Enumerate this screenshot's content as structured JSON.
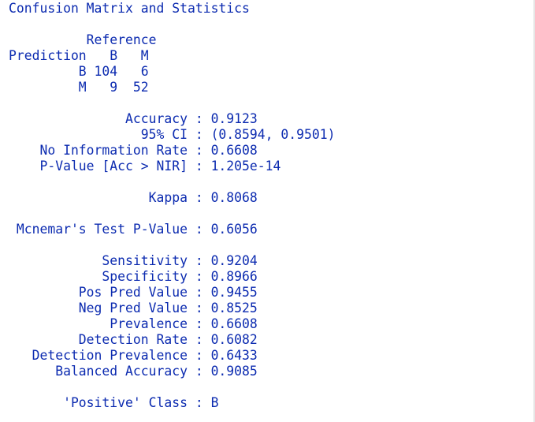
{
  "console": {
    "header": "Confusion Matrix and Statistics",
    "matrix": {
      "reference_label": "          Reference",
      "column_header": "Prediction   B   M",
      "rows": [
        "         B 104   6",
        "         M   9  52"
      ]
    },
    "overall": [
      "               Accuracy : 0.9123",
      "                 95% CI : (0.8594, 0.9501)",
      "    No Information Rate : 0.6608",
      "    P-Value [Acc > NIR] : 1.205e-14"
    ],
    "kappa": "                  Kappa : 0.8068",
    "mcnemar": " Mcnemar's Test P-Value : 0.6056",
    "class_stats": [
      "            Sensitivity : 0.9204",
      "            Specificity : 0.8966",
      "         Pos Pred Value : 0.9455",
      "         Neg Pred Value : 0.8525",
      "             Prevalence : 0.6608",
      "         Detection Rate : 0.6082",
      "   Detection Prevalence : 0.6433",
      "      Balanced Accuracy : 0.9085"
    ],
    "positive_class": "       'Positive' Class : B",
    "text_color": "#0c2bb0"
  }
}
